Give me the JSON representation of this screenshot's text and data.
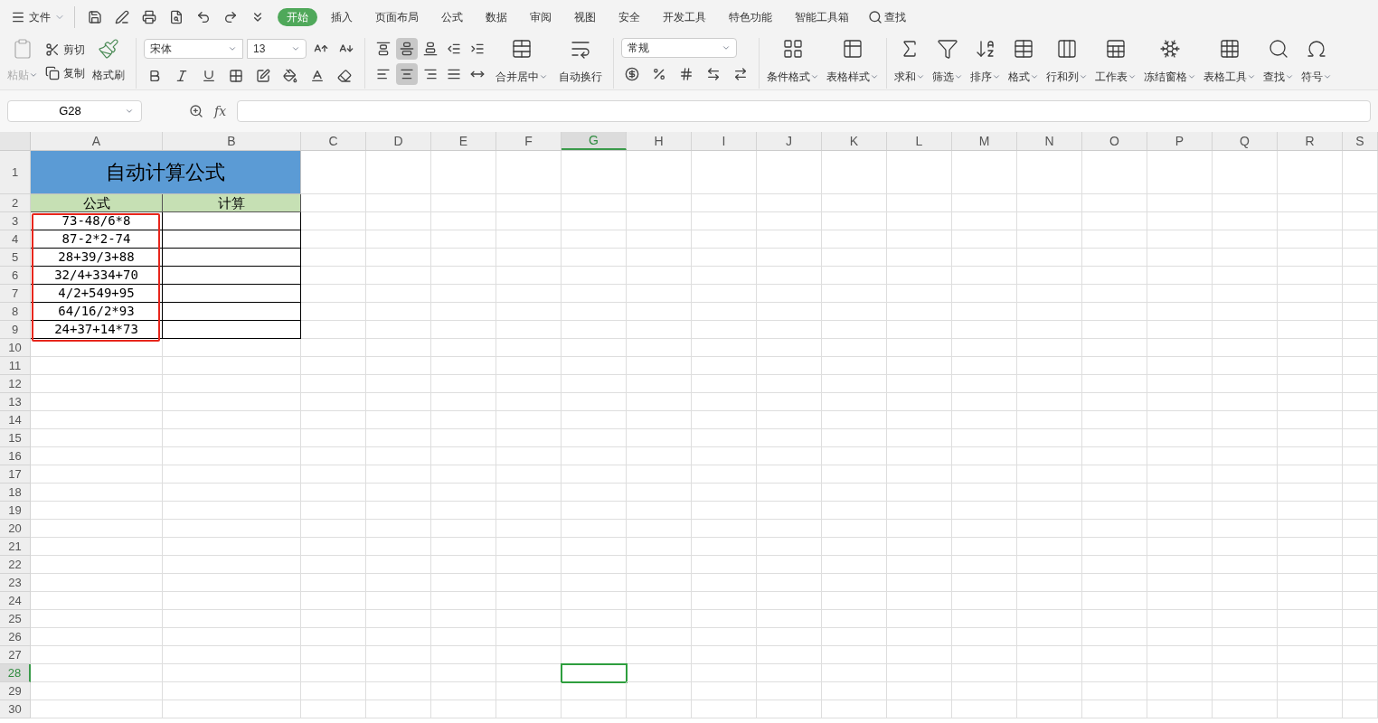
{
  "menu": {
    "file_label": "文件",
    "tabs": [
      {
        "label": "开始",
        "selected": true
      },
      {
        "label": "插入",
        "selected": false
      },
      {
        "label": "页面布局",
        "selected": false
      },
      {
        "label": "公式",
        "selected": false
      },
      {
        "label": "数据",
        "selected": false
      },
      {
        "label": "审阅",
        "selected": false
      },
      {
        "label": "视图",
        "selected": false
      },
      {
        "label": "安全",
        "selected": false
      },
      {
        "label": "开发工具",
        "selected": false
      },
      {
        "label": "特色功能",
        "selected": false
      },
      {
        "label": "智能工具箱",
        "selected": false
      }
    ],
    "search": "查找"
  },
  "clipboard": {
    "paste": {
      "label": "粘贴",
      "disabled": true
    },
    "cut": "剪切",
    "copy": "复制",
    "format_painter": "格式刷"
  },
  "font": {
    "name": "宋体",
    "size": "13"
  },
  "alignment_buttons": [
    {
      "label": "合并居中",
      "dropdown": true
    },
    {
      "label": "自动换行",
      "dropdown": false
    }
  ],
  "number_format": "常规",
  "tool_buttons": [
    {
      "label": "条件格式",
      "dropdown": true
    },
    {
      "label": "表格样式",
      "dropdown": true
    },
    {
      "label": "求和",
      "dropdown": true
    },
    {
      "label": "筛选",
      "dropdown": true
    },
    {
      "label": "排序",
      "dropdown": true
    },
    {
      "label": "格式",
      "dropdown": true
    },
    {
      "label": "行和列",
      "dropdown": true
    },
    {
      "label": "工作表",
      "dropdown": true
    },
    {
      "label": "冻结窗格",
      "dropdown": true
    },
    {
      "label": "表格工具",
      "dropdown": true
    },
    {
      "label": "查找",
      "dropdown": true
    },
    {
      "label": "符号",
      "dropdown": true
    }
  ],
  "name_box": "G28",
  "formula_bar": {
    "fx": "fx"
  },
  "sheet": {
    "columns": [
      {
        "label": "A",
        "selected": false
      },
      {
        "label": "B",
        "selected": false
      },
      {
        "label": "C",
        "selected": false
      },
      {
        "label": "D",
        "selected": false
      },
      {
        "label": "E",
        "selected": false
      },
      {
        "label": "F",
        "selected": false
      },
      {
        "label": "G",
        "selected": true
      },
      {
        "label": "H",
        "selected": false
      },
      {
        "label": "I",
        "selected": false
      },
      {
        "label": "J",
        "selected": false
      },
      {
        "label": "K",
        "selected": false
      },
      {
        "label": "L",
        "selected": false
      },
      {
        "label": "M",
        "selected": false
      },
      {
        "label": "N",
        "selected": false
      },
      {
        "label": "O",
        "selected": false
      },
      {
        "label": "P",
        "selected": false
      },
      {
        "label": "Q",
        "selected": false
      },
      {
        "label": "R",
        "selected": false
      },
      {
        "label": "S",
        "selected": false
      }
    ],
    "rows": [
      {
        "label": "1",
        "selected": false
      },
      {
        "label": "2",
        "selected": false
      },
      {
        "label": "3",
        "selected": false
      },
      {
        "label": "4",
        "selected": false
      },
      {
        "label": "5",
        "selected": false
      },
      {
        "label": "6",
        "selected": false
      },
      {
        "label": "7",
        "selected": false
      },
      {
        "label": "8",
        "selected": false
      },
      {
        "label": "9",
        "selected": false
      },
      {
        "label": "10",
        "selected": false
      },
      {
        "label": "11",
        "selected": false
      },
      {
        "label": "12",
        "selected": false
      },
      {
        "label": "13",
        "selected": false
      },
      {
        "label": "14",
        "selected": false
      },
      {
        "label": "15",
        "selected": false
      },
      {
        "label": "16",
        "selected": false
      },
      {
        "label": "17",
        "selected": false
      },
      {
        "label": "18",
        "selected": false
      },
      {
        "label": "19",
        "selected": false
      },
      {
        "label": "20",
        "selected": false
      },
      {
        "label": "21",
        "selected": false
      },
      {
        "label": "22",
        "selected": false
      },
      {
        "label": "23",
        "selected": false
      },
      {
        "label": "24",
        "selected": false
      },
      {
        "label": "25",
        "selected": false
      },
      {
        "label": "26",
        "selected": false
      },
      {
        "label": "27",
        "selected": false
      },
      {
        "label": "28",
        "selected": true
      },
      {
        "label": "29",
        "selected": false
      },
      {
        "label": "30",
        "selected": false
      }
    ],
    "title": "自动计算公式",
    "headers": [
      "公式",
      "计算"
    ],
    "formulas": [
      "73-48/6*8",
      "87-2*2-74",
      "28+39/3+88",
      "32/4+334+70",
      "4/2+549+95",
      "64/16/2*93",
      "24+37+14*73"
    ]
  }
}
